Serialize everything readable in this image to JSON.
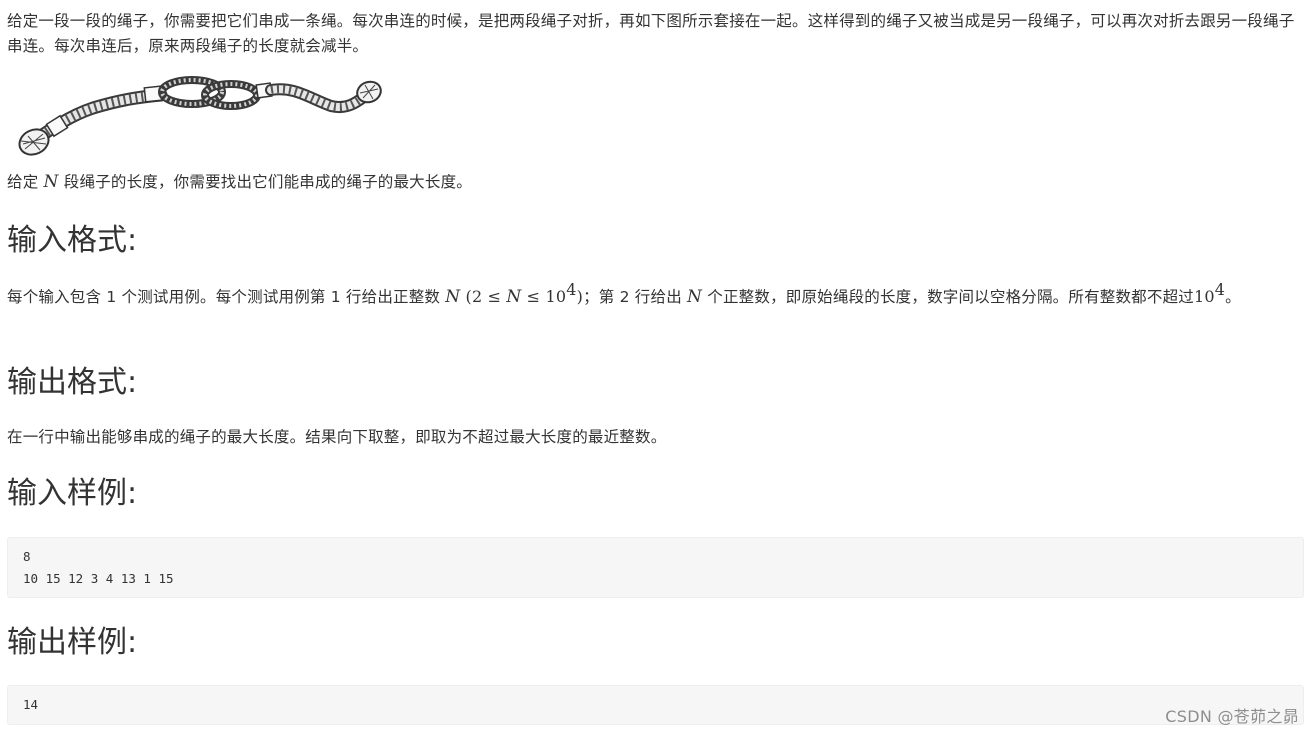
{
  "intro": "给定一段一段的绳子，你需要把它们串成一条绳。每次串连的时候，是把两段绳子对折，再如下图所示套接在一起。这样得到的绳子又被当成是另一段绳子，可以再次对折去跟另一段绳子串连。每次串连后，原来两段绳子的长度就会减半。",
  "given": {
    "before": "给定",
    "var": "N",
    "after": "段绳子的长度，你需要找出它们能串成的绳子的最大长度。"
  },
  "sections": {
    "input_format_title": "输入格式:",
    "output_format_title": "输出格式:",
    "input_sample_title": "输入样例:",
    "output_sample_title": "输出样例:"
  },
  "input_desc": {
    "part1": "每个输入包含 1 个测试用例。每个测试用例第 1 行给出正整数",
    "var_n": "N",
    "range_open": "(2 ≤",
    "range_n": "N",
    "range_le": "≤ 10",
    "range_exp": "4",
    "range_close": ")",
    "part2": "；第 2 行给出",
    "var_n2": "N",
    "part3": "个正整数，即原始绳段的长度，数字间以空格分隔。所有整数都不超过",
    "limit_base": "10",
    "limit_exp": "4",
    "part4": "。"
  },
  "output_desc": "在一行中输出能够串成的绳子的最大长度。结果向下取整，即取为不超过最大长度的最近整数。",
  "sample_input": "8\n10 15 12 3 4 13 1 15",
  "sample_output": "14",
  "watermark": "CSDN @苍茆之昴"
}
